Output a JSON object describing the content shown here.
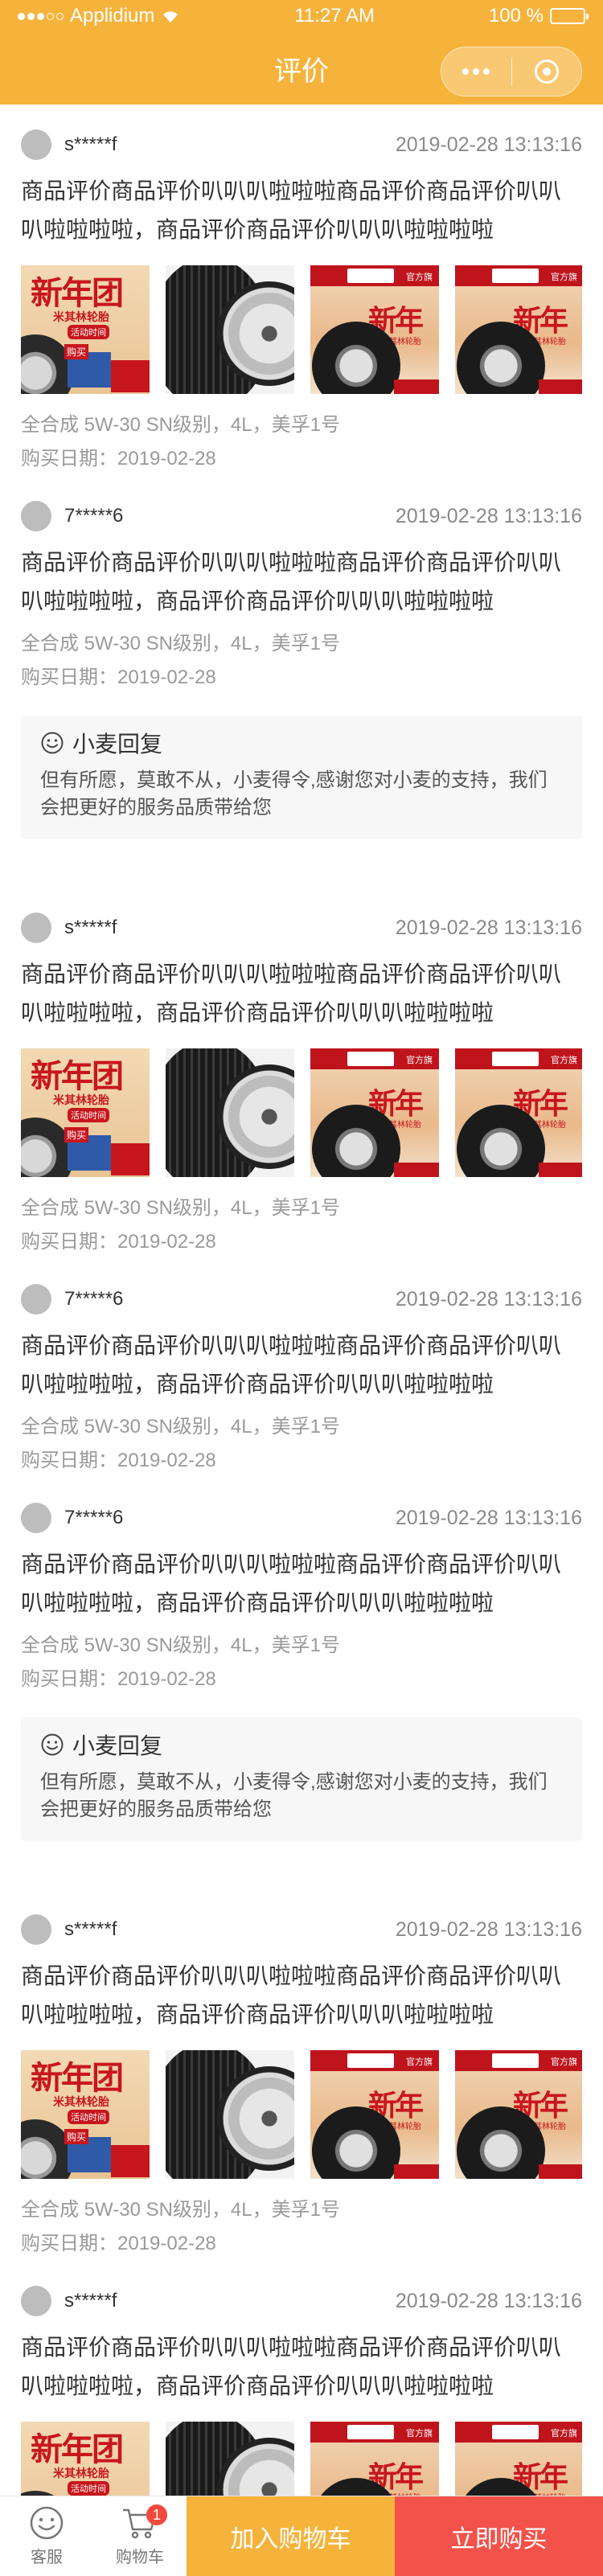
{
  "status_bar": {
    "carrier": "Applidium",
    "time": "11:27 AM",
    "battery": "100 %"
  },
  "nav": {
    "title": "评价"
  },
  "reviews": [
    {
      "user": "s*****f",
      "time": "2019-02-28 13:13:16",
      "content": "商品评价商品评价叭叭叭啦啦啦商品评价商品评价叭叭叭啦啦啦啦，商品评价商品评价叭叭叭啦啦啦啦",
      "has_images": true,
      "spec": "全合成 5W-30 SN级别，4L，美孚1号",
      "purchase": "购买日期：2019-02-28",
      "reply": null
    },
    {
      "user": "7*****6",
      "time": "2019-02-28 13:13:16",
      "content": "商品评价商品评价叭叭叭啦啦啦商品评价商品评价叭叭叭啦啦啦啦，商品评价商品评价叭叭叭啦啦啦啦",
      "has_images": false,
      "spec": "全合成 5W-30 SN级别，4L，美孚1号",
      "purchase": "购买日期：2019-02-28",
      "reply": {
        "title": "小麦回复",
        "text": "但有所愿，莫敢不从，小麦得令,感谢您对小麦的支持，我们会把更好的服务品质带给您"
      }
    },
    {
      "user": "s*****f",
      "time": "2019-02-28 13:13:16",
      "content": "商品评价商品评价叭叭叭啦啦啦商品评价商品评价叭叭叭啦啦啦啦，商品评价商品评价叭叭叭啦啦啦啦",
      "has_images": true,
      "spec": "全合成 5W-30 SN级别，4L，美孚1号",
      "purchase": "购买日期：2019-02-28",
      "reply": null
    },
    {
      "user": "7*****6",
      "time": "2019-02-28 13:13:16",
      "content": "商品评价商品评价叭叭叭啦啦啦商品评价商品评价叭叭叭啦啦啦啦，商品评价商品评价叭叭叭啦啦啦啦",
      "has_images": false,
      "spec": "全合成 5W-30 SN级别，4L，美孚1号",
      "purchase": "购买日期：2019-02-28",
      "reply": null
    },
    {
      "user": "7*****6",
      "time": "2019-02-28 13:13:16",
      "content": "商品评价商品评价叭叭叭啦啦啦商品评价商品评价叭叭叭啦啦啦啦，商品评价商品评价叭叭叭啦啦啦啦",
      "has_images": false,
      "spec": "全合成 5W-30 SN级别，4L，美孚1号",
      "purchase": "购买日期：2019-02-28",
      "reply": {
        "title": "小麦回复",
        "text": "但有所愿，莫敢不从，小麦得令,感谢您对小麦的支持，我们会把更好的服务品质带给您"
      }
    },
    {
      "user": "s*****f",
      "time": "2019-02-28 13:13:16",
      "content": "商品评价商品评价叭叭叭啦啦啦商品评价商品评价叭叭叭啦啦啦啦，商品评价商品评价叭叭叭啦啦啦啦",
      "has_images": true,
      "spec": "全合成 5W-30 SN级别，4L，美孚1号",
      "purchase": "购买日期：2019-02-28",
      "reply": null
    },
    {
      "user": "s*****f",
      "time": "2019-02-28 13:13:16",
      "content": "商品评价商品评价叭叭叭啦啦啦商品评价商品评价叭叭叭啦啦啦啦，商品评价商品评价叭叭叭啦啦啦啦",
      "has_images": true,
      "spec": "",
      "purchase": "",
      "reply": null
    }
  ],
  "bottom_bar": {
    "service_label": "客服",
    "cart_label": "购物车",
    "cart_count": "1",
    "add_to_cart": "加入购物车",
    "buy_now": "立即购买"
  },
  "colors": {
    "brand": "#f6b33c",
    "buy": "#f2524a",
    "badge": "#f14a3d"
  },
  "icons": [
    "signal-icon",
    "wifi-icon",
    "battery-icon",
    "more-icon",
    "close-target-icon",
    "smile-icon",
    "service-icon",
    "cart-icon"
  ]
}
